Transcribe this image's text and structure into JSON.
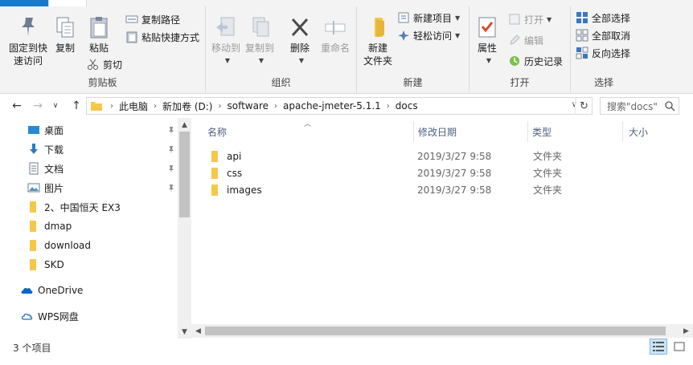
{
  "ribbon": {
    "clipboard": {
      "group_label": "剪贴板",
      "pin_label_1": "固定到快",
      "pin_label_2": "速访问",
      "copy_label": "复制",
      "paste_label": "粘贴",
      "copy_path_label": "复制路径",
      "paste_shortcut_label": "粘贴快捷方式",
      "cut_label": "剪切"
    },
    "organize": {
      "group_label": "组织",
      "move_to_label": "移动到",
      "copy_to_label": "复制到",
      "delete_label": "删除",
      "rename_label": "重命名"
    },
    "new": {
      "group_label": "新建",
      "new_folder_label_1": "新建",
      "new_folder_label_2": "文件夹",
      "new_item_label": "新建项目",
      "easy_access_label": "轻松访问"
    },
    "open": {
      "group_label": "打开",
      "properties_label": "属性",
      "open_label": "打开",
      "edit_label": "编辑",
      "history_label": "历史记录"
    },
    "select": {
      "group_label": "选择",
      "select_all_label": "全部选择",
      "select_none_label": "全部取消",
      "invert_label": "反向选择"
    }
  },
  "address": {
    "crumbs": [
      "此电脑",
      "新加卷 (D:)",
      "software",
      "apache-jmeter-5.1.1",
      "docs"
    ],
    "search_placeholder": "搜索\"docs\""
  },
  "nav": {
    "items": [
      {
        "label": "桌面",
        "icon": "desktop-icon"
      },
      {
        "label": "下载",
        "icon": "download-icon"
      },
      {
        "label": "文档",
        "icon": "document-icon"
      },
      {
        "label": "图片",
        "icon": "picture-icon"
      },
      {
        "label": "2、中国恒天 EX3",
        "icon": "folder-icon"
      },
      {
        "label": "dmap",
        "icon": "folder-icon"
      },
      {
        "label": "download",
        "icon": "folder-icon"
      },
      {
        "label": "SKD",
        "icon": "folder-icon"
      },
      {
        "label": "OneDrive",
        "icon": "onedrive-icon"
      },
      {
        "label": "WPS网盘",
        "icon": "wps-cloud-icon"
      }
    ]
  },
  "files": {
    "columns": {
      "name": "名称",
      "date": "修改日期",
      "type": "类型",
      "size": "大小"
    },
    "rows": [
      {
        "name": "api",
        "date": "2019/3/27 9:58",
        "type": "文件夹"
      },
      {
        "name": "css",
        "date": "2019/3/27 9:58",
        "type": "文件夹"
      },
      {
        "name": "images",
        "date": "2019/3/27 9:58",
        "type": "文件夹"
      }
    ]
  },
  "status": {
    "count": "3 个项目"
  },
  "colors": {
    "folder": "#f5c84c",
    "accent": "#1979ca",
    "ribbon_bg": "#f3f3f3"
  }
}
